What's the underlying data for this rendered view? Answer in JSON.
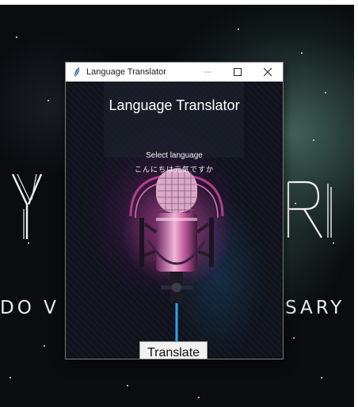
{
  "wallpaper": {
    "left_text": "DO V",
    "right_text": "SARY",
    "left_glyph": "Y",
    "right_glyph": "R"
  },
  "window": {
    "title": "Language Translator",
    "icon": "feather-icon",
    "controls": [
      "minimize-icon",
      "maximize-icon",
      "close-icon"
    ]
  },
  "app": {
    "heading": "Language Translator",
    "select_label": "Select language",
    "text_line": "こんにちは元気ですか",
    "translate_label": "Translate"
  },
  "colors": {
    "window_background": "#15161d",
    "titlebar": "#ffffff",
    "mic_glow_pink": "#e14aa5",
    "mic_glow_blue": "#2aa6e6"
  }
}
